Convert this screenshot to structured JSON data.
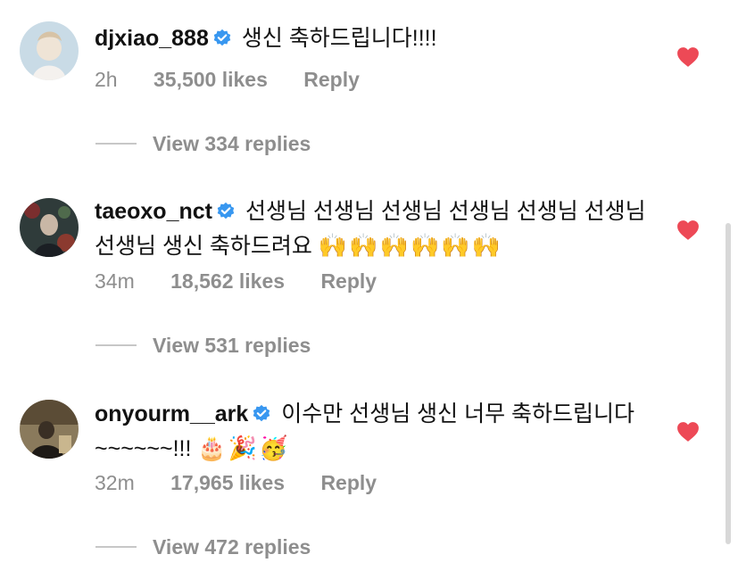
{
  "comments": [
    {
      "username": "djxiao_888",
      "text": "생신 축하드립니다!!!!",
      "emoji": "",
      "time": "2h",
      "likes": "35,500 likes",
      "reply_label": "Reply",
      "view_replies": "View 334 replies"
    },
    {
      "username": "taeoxo_nct",
      "text": "선생님 선생님 선생님 선생님 선생님 선생님 선생님 생신 축하드려요",
      "emoji": "🙌🙌🙌🙌🙌🙌",
      "time": "34m",
      "likes": "18,562 likes",
      "reply_label": "Reply",
      "view_replies": "View 531 replies"
    },
    {
      "username": "onyourm__ark",
      "text": "이수만 선생님 생신 너무 축하드립니다~~~~~~!!!",
      "emoji": "🎂🎉🥳",
      "time": "32m",
      "likes": "17,965 likes",
      "reply_label": "Reply",
      "view_replies": "View 472 replies"
    }
  ],
  "icons": {
    "verified": "verified-badge-icon",
    "like": "heart-icon"
  },
  "colors": {
    "heart": "#ed4956",
    "verified": "#3897f0",
    "muted_text": "#8e8e8e"
  }
}
